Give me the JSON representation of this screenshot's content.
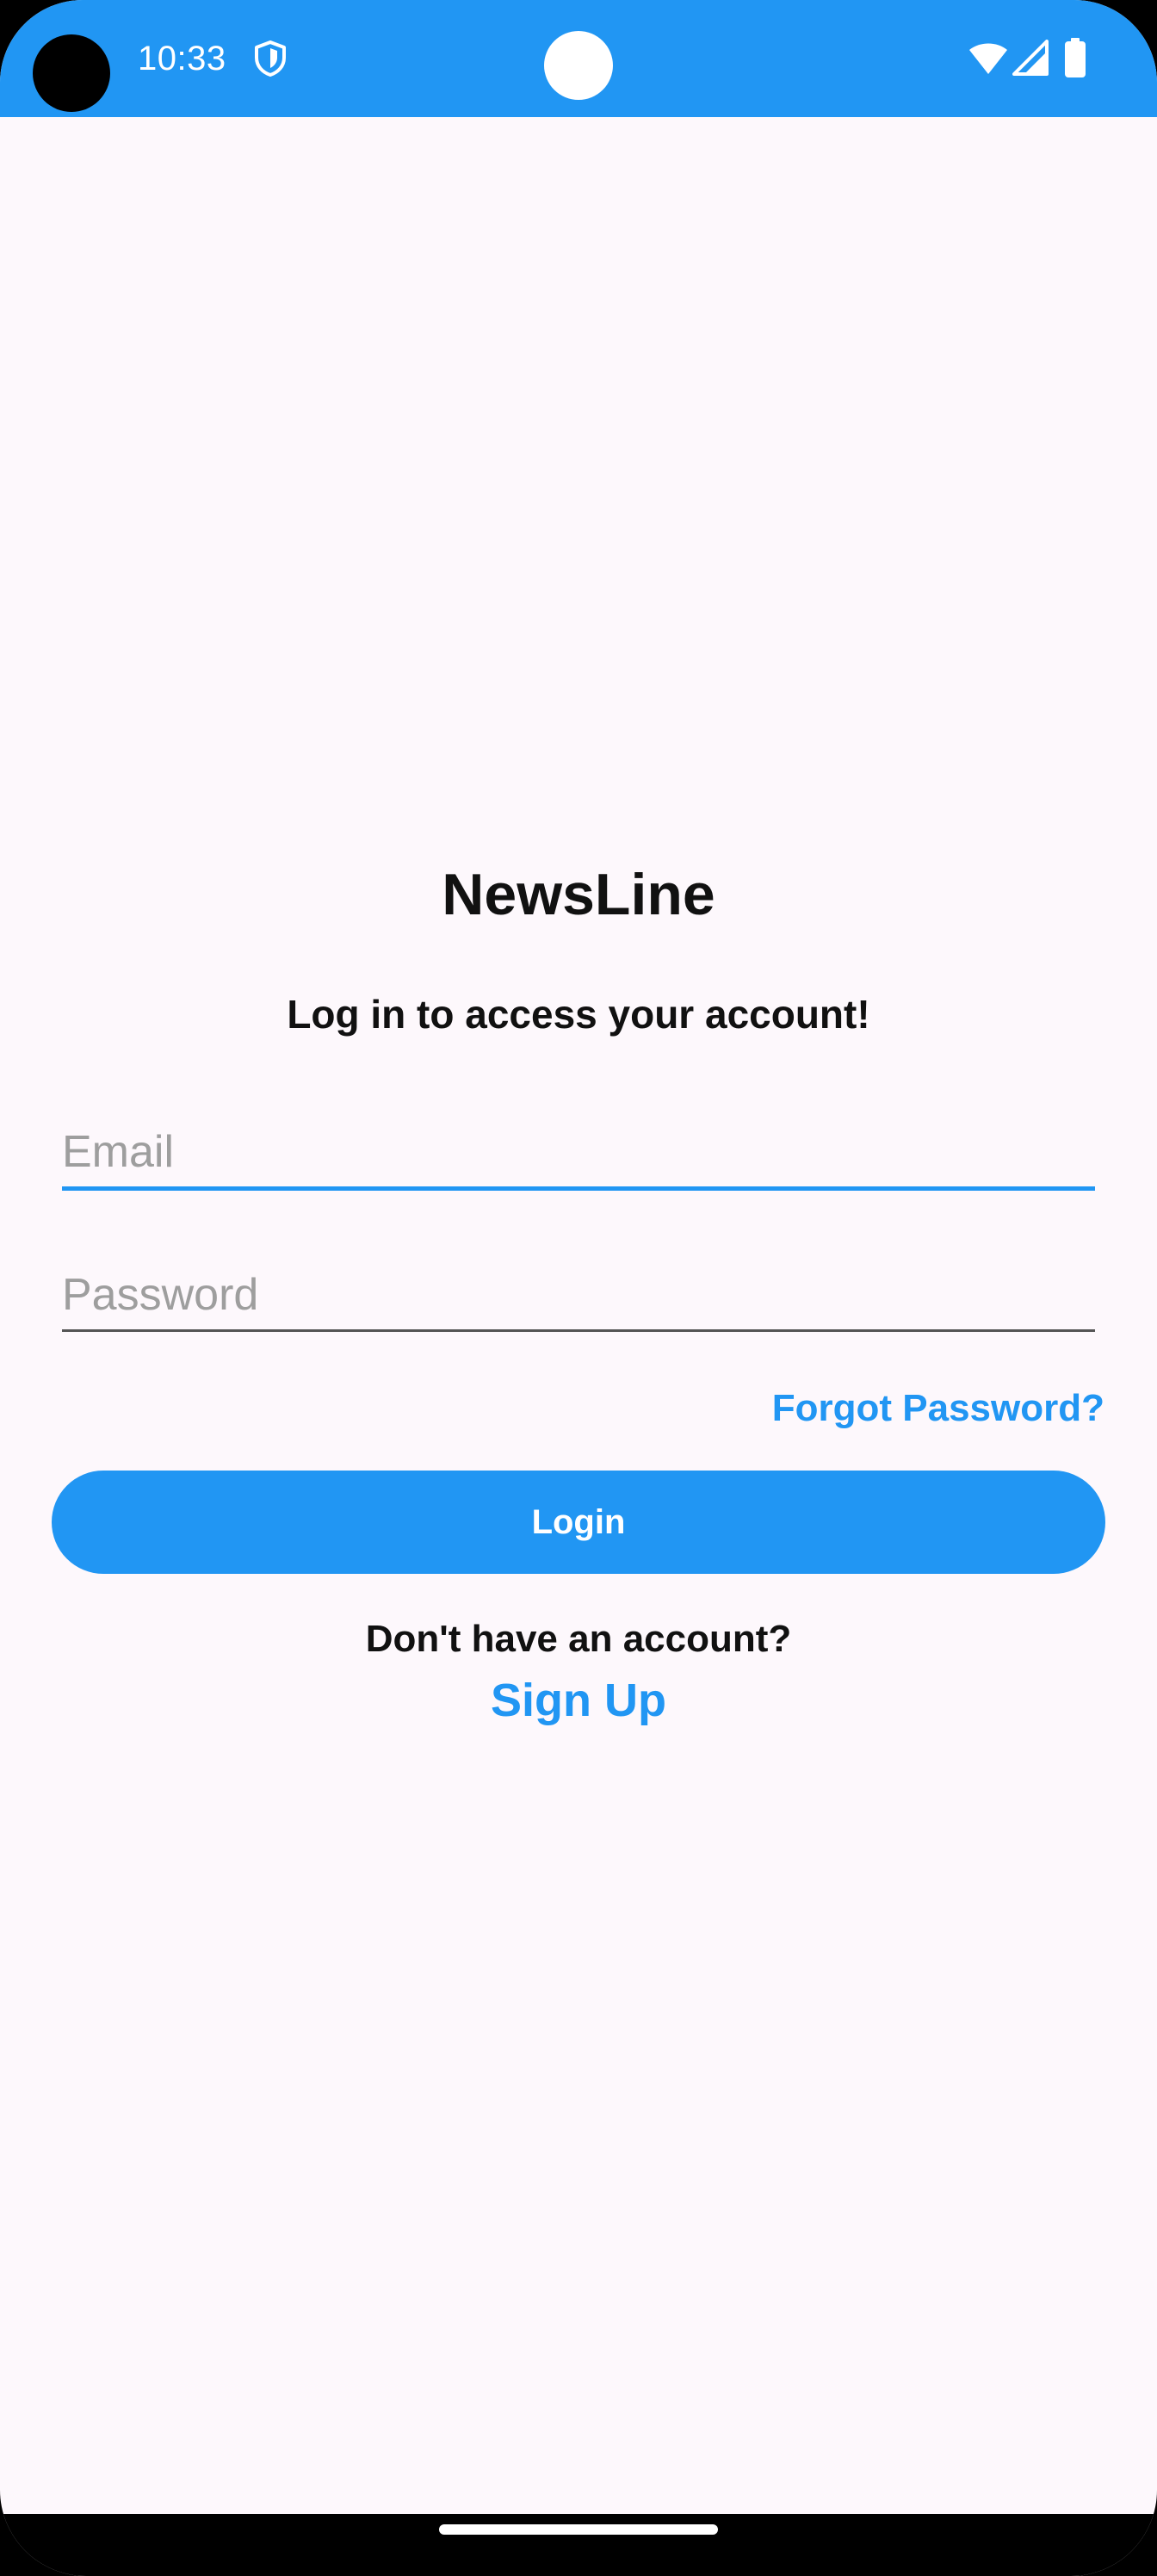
{
  "status_bar": {
    "time": "10:33",
    "color": "#2196F3",
    "icons": [
      "shield-icon",
      "wifi-icon",
      "signal-icon",
      "battery-icon"
    ]
  },
  "login": {
    "app_title": "NewsLine",
    "subtitle": "Log in to access your account!",
    "email_placeholder": "Email",
    "email_value": "",
    "password_placeholder": "Password",
    "password_value": "",
    "forgot_password_label": "Forgot Password?",
    "login_button_label": "Login",
    "no_account_text": "Don't have an account?",
    "signup_label": "Sign Up"
  },
  "colors": {
    "accent": "#2196F3",
    "background": "#FDF8FC",
    "text": "#111111"
  }
}
